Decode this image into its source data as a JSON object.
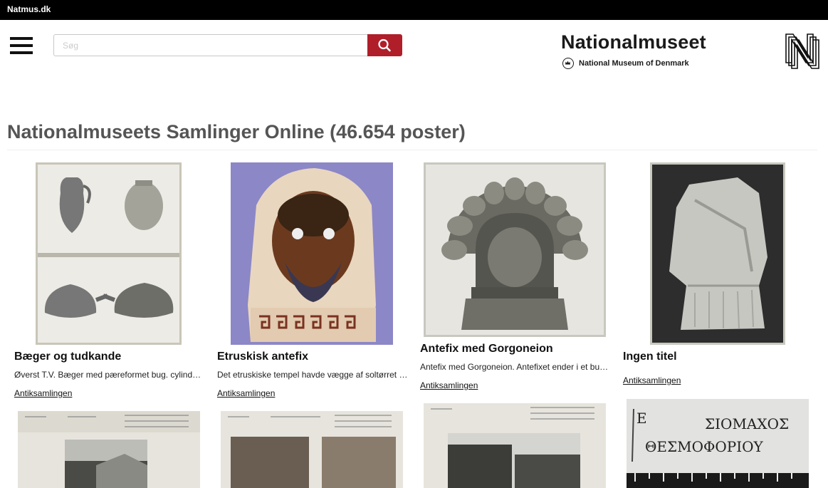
{
  "topbar": {
    "site_label": "Natmus.dk"
  },
  "search": {
    "placeholder": "Søg"
  },
  "brand": {
    "name": "Nationalmuseet",
    "subtitle": "National Museum of Denmark"
  },
  "page": {
    "title": "Nationalmuseets Samlinger Online (46.654 poster)"
  },
  "cards": [
    {
      "title": "Bæger og tudkande",
      "description": "Øverst T.V. Bæger med pæreformet bug. cylinderformet hals og hank",
      "collection": "Antiksamlingen"
    },
    {
      "title": "Etruskisk antefix",
      "description": "Det etruskiske tempel havde vægge af soltørret ler og tag af træ",
      "collection": "Antiksamlingen"
    },
    {
      "title": "Antefix med Gorgoneion",
      "description": "Antefix med Gorgoneion. Antefixet ender i et bueformet felt med palmetter",
      "collection": "Antiksamlingen"
    },
    {
      "title": "Ingen titel",
      "description": "",
      "collection": "Antiksamlingen"
    }
  ],
  "inscription": {
    "line1": "ΣΙΟΜΑΧΟΣ",
    "line2": "ΘΕΣΜΟΦΟΡΙΟΥ",
    "letter": "E"
  },
  "colors": {
    "accent": "#b01e2a",
    "topbar": "#000000",
    "title": "#555555"
  }
}
